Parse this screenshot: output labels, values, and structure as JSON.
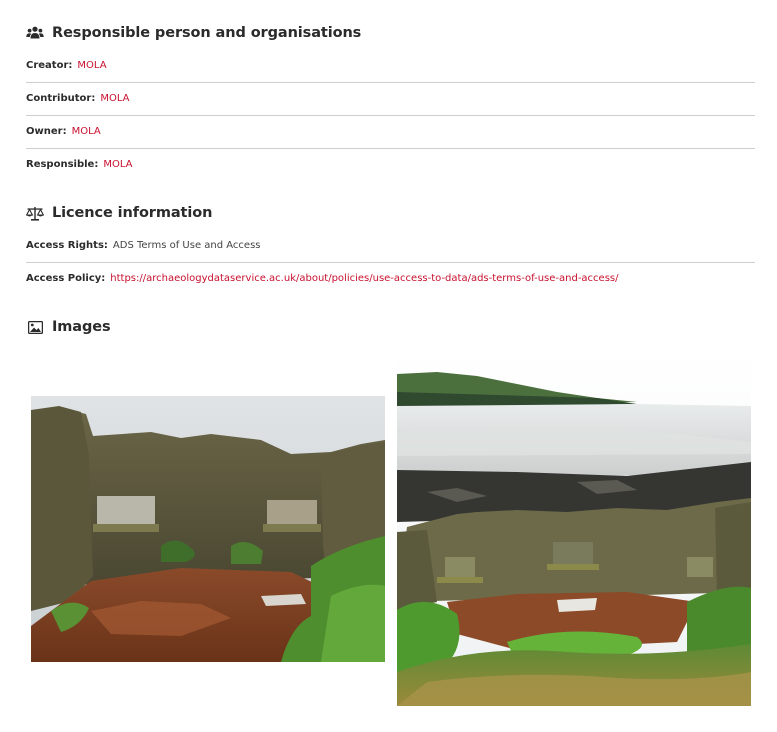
{
  "responsible_section": {
    "title": "Responsible person and organisations",
    "icon": "users-icon",
    "rows": [
      {
        "label": "Creator:",
        "value": "MOLA"
      },
      {
        "label": "Contributor:",
        "value": "MOLA"
      },
      {
        "label": "Owner:",
        "value": "MOLA"
      },
      {
        "label": "Responsible:",
        "value": "MOLA"
      }
    ]
  },
  "licence_section": {
    "title": "Licence information",
    "icon": "balance-scale-icon",
    "access_rights": {
      "label": "Access Rights:",
      "value": "ADS Terms of Use and Access"
    },
    "access_policy": {
      "label": "Access Policy:",
      "value": "https://archaeologydataservice.ac.uk/about/policies/use-access-to-data/ads-terms-of-use-and-access/"
    }
  },
  "images_section": {
    "title": "Images",
    "icon": "image-icon"
  },
  "colors": {
    "link": "#c8102e",
    "text": "#2b2b2b",
    "divider": "#cfcfcf"
  }
}
